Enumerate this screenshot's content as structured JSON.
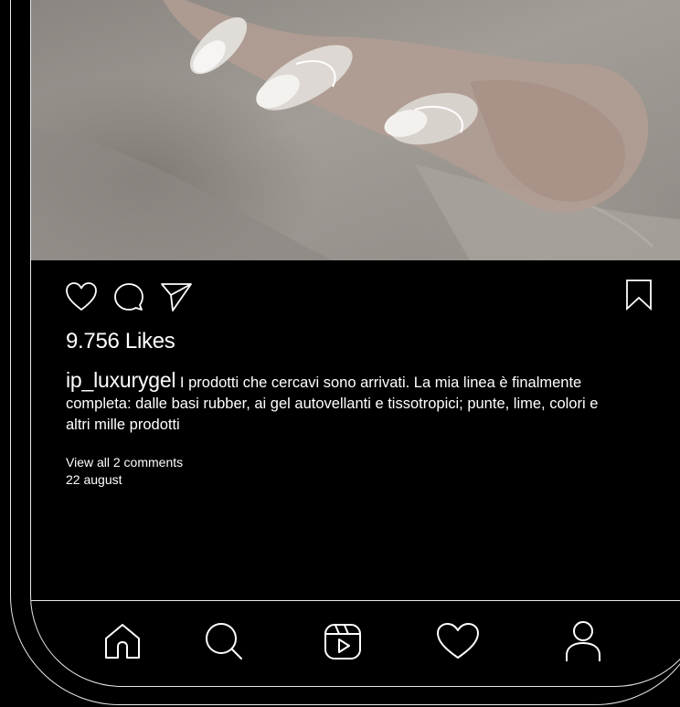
{
  "post": {
    "likes": "9.756 Likes",
    "username": "ip_luxurygel",
    "caption": " I prodotti che cercavi sono arrivati. La mia linea è finalmente completa: dalle basi rubber, ai gel autovellanti e tissotropici; punte, lime, colori e altri mille prodotti",
    "view_comments": "View all 2 comments",
    "date": "22 august"
  },
  "actions": {
    "icons": [
      "heart-icon",
      "comment-icon",
      "share-icon",
      "bookmark-icon"
    ]
  },
  "bottom_nav": {
    "items": [
      "home-icon",
      "search-icon",
      "reels-icon",
      "activity-heart-icon",
      "profile-icon"
    ]
  },
  "colors": {
    "background": "#000000",
    "foreground": "#ffffff",
    "frame": "#e8e8e8"
  }
}
